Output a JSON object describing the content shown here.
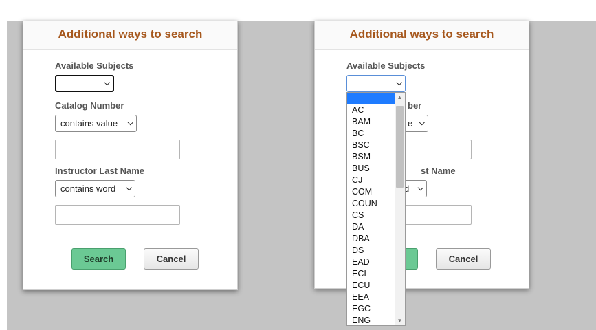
{
  "modal": {
    "title": "Additional ways to search",
    "available_subjects_label": "Available Subjects",
    "catalog_number_label": "Catalog Number",
    "catalog_operator": "contains value",
    "instructor_label": "Instructor Last Name",
    "instructor_operator": "contains word",
    "search_button": "Search",
    "cancel_button": "Cancel"
  },
  "modal2_clipped": {
    "catalog_label_fragment": "ber",
    "catalog_operator_fragment": "e",
    "instructor_label_fragment": "st Name",
    "instructor_operator_fragment": "d"
  },
  "subjects_dropdown": {
    "selected_value": "",
    "options": [
      "",
      "AC",
      "BAM",
      "BC",
      "BSC",
      "BSM",
      "BUS",
      "CJ",
      "COM",
      "COUN",
      "CS",
      "DA",
      "DBA",
      "DS",
      "EAD",
      "ECI",
      "ECU",
      "EEA",
      "EGC",
      "ENG"
    ]
  },
  "colors": {
    "title": "#a6571c",
    "primary_button": "#6bc994",
    "selected_option": "#1e7bff",
    "backdrop": "#c4c4c4"
  },
  "icons": {
    "chevron": "chevron-down-icon",
    "scroll_up": "scroll-up-arrow-icon",
    "scroll_down": "scroll-down-arrow-icon"
  }
}
